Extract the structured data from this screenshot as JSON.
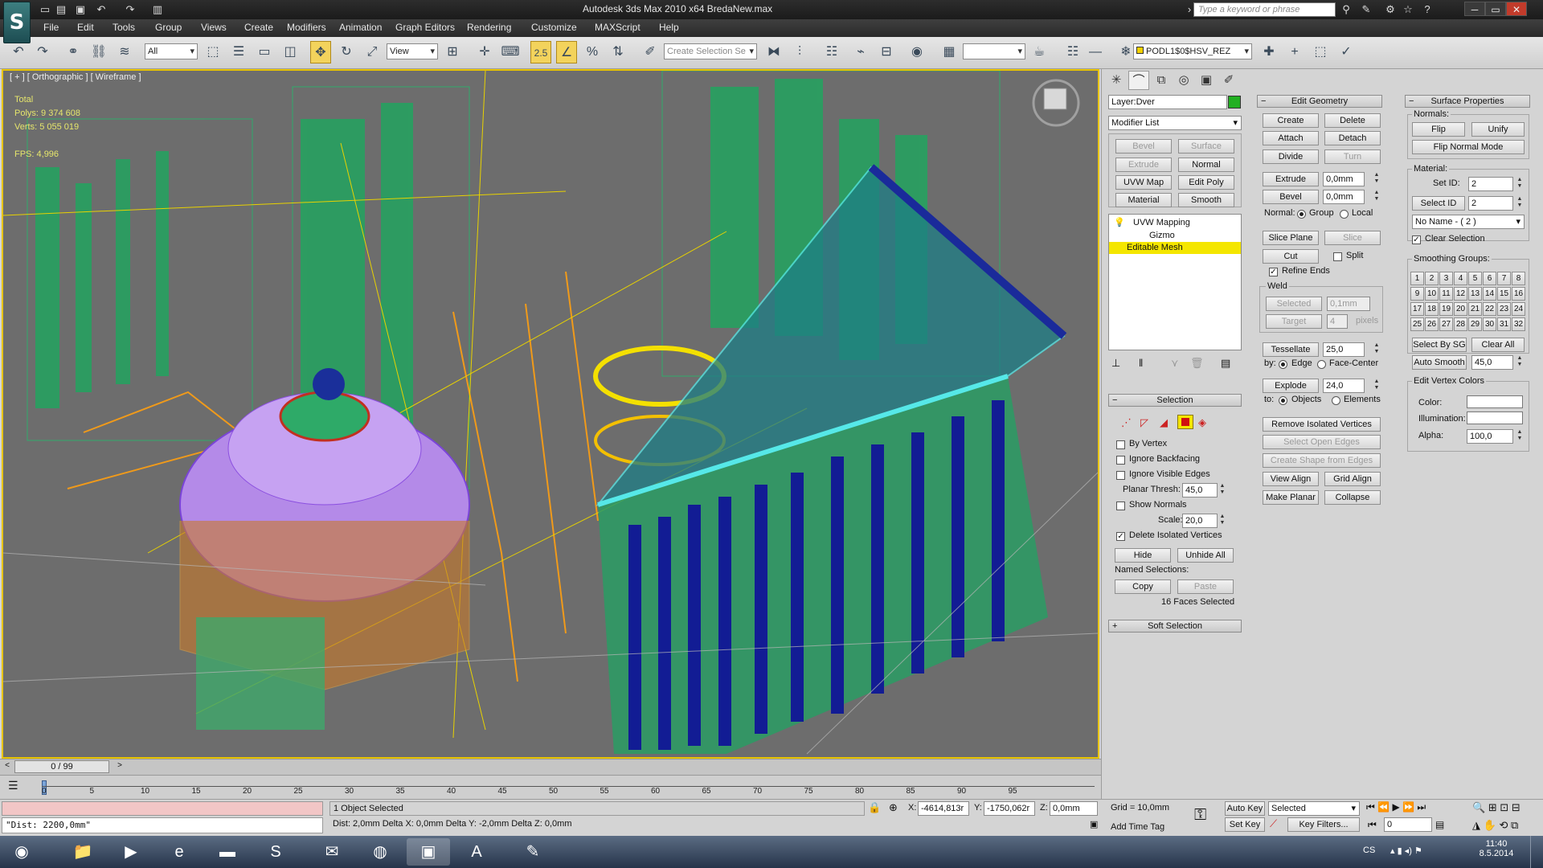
{
  "titlebar": {
    "logo": "S",
    "title": "Autodesk 3ds Max  2010 x64      BredaNew.max",
    "search_placeholder": "Type a keyword or phrase",
    "icons": [
      "new-file-icon",
      "open-file-icon",
      "save-icon",
      "undo-icon",
      "redo-icon",
      "project-folder-icon"
    ],
    "right_icons": [
      "binoculars-icon",
      "tools-icon",
      "communication-center-icon",
      "favorites-star-icon",
      "help-icon"
    ]
  },
  "menu": {
    "items": [
      "File",
      "Edit",
      "Tools",
      "Group",
      "Views",
      "Create",
      "Modifiers",
      "Animation",
      "Graph Editors",
      "Rendering",
      "Customize",
      "MAXScript",
      "Help"
    ]
  },
  "toolbar": {
    "selection_filter": "All",
    "reference_coord": "View",
    "snap_label": "2.5",
    "named_selection_placeholder": "Create Selection Se",
    "layer_name": "PODL1$0$HSV_REZ"
  },
  "viewport": {
    "label": "[ + ] [ Orthographic ] [ Wireframe ]",
    "stats": {
      "total_label": "Total",
      "polys_label": "Polys:",
      "polys_value": "9 374 608",
      "verts_label": "Verts:",
      "verts_value": "5 055 019",
      "fps_label": "FPS:",
      "fps_value": "4,996"
    }
  },
  "command_panel": {
    "tabs": [
      "create-tab-icon",
      "modify-tab-icon",
      "hierarchy-tab-icon",
      "motion-tab-icon",
      "display-tab-icon",
      "utilities-tab-icon"
    ],
    "object_name": "Layer:Dver",
    "object_color": "#22b022",
    "modifier_list_label": "Modifier List",
    "quick_buttons": [
      {
        "label": "Bevel",
        "enabled": false
      },
      {
        "label": "Surface",
        "enabled": false
      },
      {
        "label": "Extrude",
        "enabled": false
      },
      {
        "label": "Normal",
        "enabled": true
      },
      {
        "label": "UVW Map",
        "enabled": true
      },
      {
        "label": "Edit Poly",
        "enabled": true
      },
      {
        "label": "Material",
        "enabled": true
      },
      {
        "label": "Smooth",
        "enabled": true
      }
    ],
    "stack": {
      "uvw": "UVW Mapping",
      "gizmo": "Gizmo",
      "editable_mesh": "Editable Mesh"
    },
    "selection": {
      "title": "Selection",
      "by_vertex": "By Vertex",
      "ignore_backfacing": "Ignore Backfacing",
      "ignore_visible_edges": "Ignore Visible Edges",
      "planar_thresh_label": "Planar Thresh:",
      "planar_thresh_value": "45,0",
      "show_normals": "Show Normals",
      "scale_label": "Scale:",
      "scale_value": "20,0",
      "delete_isolated": "Delete Isolated Vertices",
      "hide": "Hide",
      "unhide_all": "Unhide All",
      "named_selections": "Named Selections:",
      "copy": "Copy",
      "paste": "Paste",
      "status": "16 Faces Selected"
    },
    "soft_selection": "Soft Selection",
    "edit_geometry": {
      "title": "Edit Geometry",
      "create": "Create",
      "delete": "Delete",
      "attach": "Attach",
      "detach": "Detach",
      "divide": "Divide",
      "turn": "Turn",
      "extrude": "Extrude",
      "extrude_value": "0,0mm",
      "bevel": "Bevel",
      "bevel_value": "0,0mm",
      "normal_label": "Normal:",
      "group": "Group",
      "local": "Local",
      "slice_plane": "Slice Plane",
      "slice": "Slice",
      "cut": "Cut",
      "split": "Split",
      "refine_ends": "Refine Ends",
      "weld_title": "Weld",
      "selected": "Selected",
      "selected_value": "0,1mm",
      "target": "Target",
      "target_value": "4",
      "pixels": "pixels",
      "tessellate": "Tessellate",
      "tessellate_value": "25,0",
      "by_label": "by:",
      "edge": "Edge",
      "face_center": "Face-Center",
      "explode": "Explode",
      "explode_value": "24,0",
      "to_label": "to:",
      "objects": "Objects",
      "elements": "Elements",
      "remove_isolated": "Remove Isolated Vertices",
      "select_open_edges": "Select Open Edges",
      "create_shape": "Create Shape from Edges",
      "view_align": "View Align",
      "grid_align": "Grid Align",
      "make_planar": "Make Planar",
      "collapse": "Collapse"
    },
    "surface_properties": {
      "title": "Surface Properties",
      "normals_label": "Normals:",
      "flip": "Flip",
      "unify": "Unify",
      "flip_normal_mode": "Flip Normal Mode",
      "material_label": "Material:",
      "set_id_label": "Set ID:",
      "set_id_value": "2",
      "select_id": "Select ID",
      "select_id_value": "2",
      "name_dropdown": "No Name - ( 2 )",
      "clear_selection": "Clear Selection",
      "smoothing_groups_label": "Smoothing Groups:",
      "smoothing_groups": [
        "1",
        "2",
        "3",
        "4",
        "5",
        "6",
        "7",
        "8",
        "9",
        "10",
        "11",
        "12",
        "13",
        "14",
        "15",
        "16",
        "17",
        "18",
        "19",
        "20",
        "21",
        "22",
        "23",
        "24",
        "25",
        "26",
        "27",
        "28",
        "29",
        "30",
        "31",
        "32"
      ],
      "select_by_sg": "Select By SG",
      "clear_all": "Clear All",
      "auto_smooth": "Auto Smooth",
      "auto_smooth_value": "45,0",
      "edit_vertex_colors": "Edit Vertex Colors",
      "color_label": "Color:",
      "illumination_label": "Illumination:",
      "alpha_label": "Alpha:",
      "alpha_value": "100,0"
    }
  },
  "timeline": {
    "frame_label": "0 / 99",
    "ticks": [
      "0",
      "5",
      "10",
      "15",
      "20",
      "25",
      "30",
      "35",
      "40",
      "45",
      "50",
      "55",
      "60",
      "65",
      "70",
      "75",
      "80",
      "85",
      "90",
      "95"
    ]
  },
  "statusbar": {
    "maxscript_line": "\"Dist: 2200,0mm\"",
    "selection_status": "1 Object Selected",
    "prompt": "Dist: 2,0mm  Delta X: 0,0mm  Delta Y: -2,0mm  Delta Z: 0,0mm",
    "x_label": "X:",
    "x_value": "-4614,813r",
    "y_label": "Y:",
    "y_value": "-1750,062r",
    "z_label": "Z:",
    "z_value": "0,0mm",
    "grid": "Grid = 10,0mm",
    "add_time_tag": "Add Time Tag",
    "auto_key": "Auto Key",
    "set_key": "Set Key",
    "key_mode": "Selected",
    "key_filters": "Key Filters...",
    "frame_value": "0"
  },
  "taskbar": {
    "lang": "CS",
    "time": "11:40",
    "date": "8.5.2014",
    "apps": [
      "windows-start-icon",
      "file-explorer-icon",
      "media-player-icon",
      "internet-explorer-icon",
      "terminal-icon",
      "skype-icon",
      "outlook-icon",
      "chrome-icon",
      "3dsmax-icon",
      "acrobat-icon",
      "notes-icon"
    ]
  }
}
